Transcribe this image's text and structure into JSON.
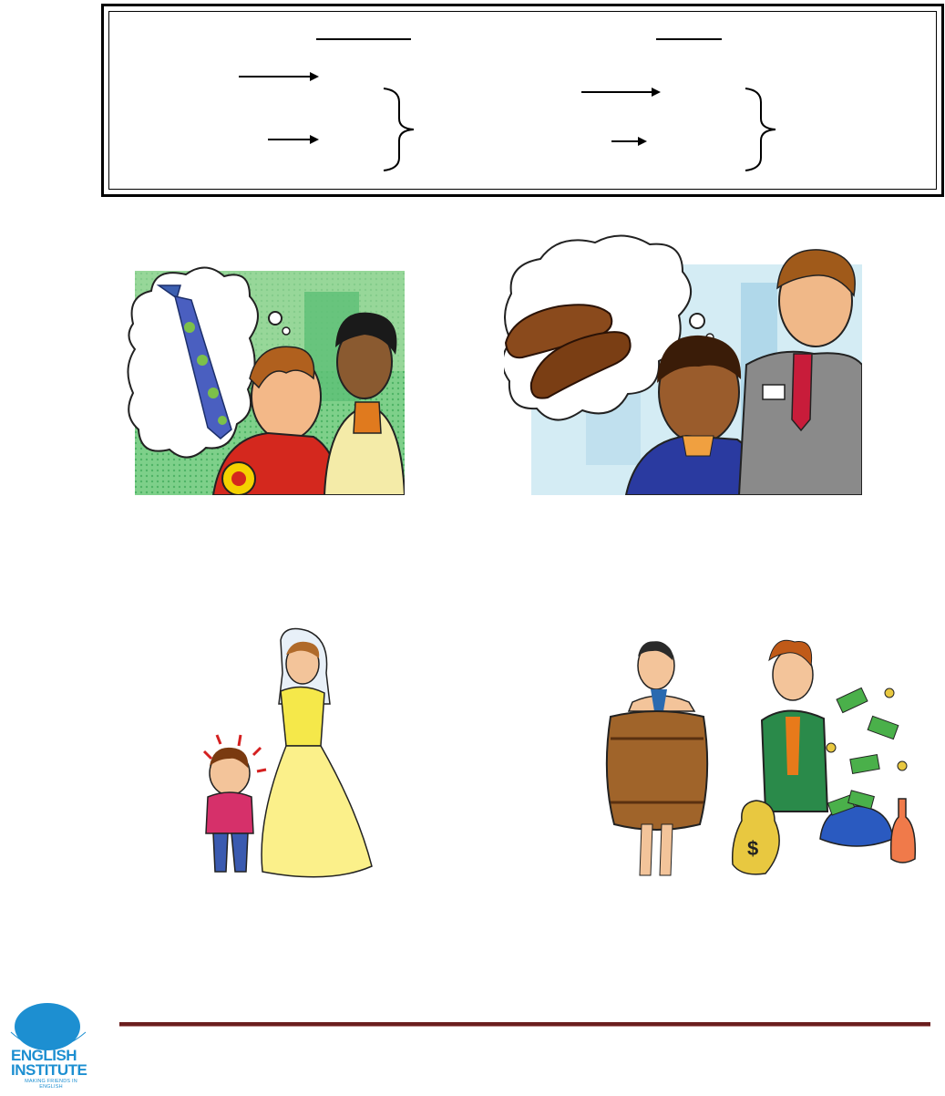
{
  "footer": {
    "logo_line1": "ENGLISH",
    "logo_line2": "INSTITUTE",
    "logo_tagline": "MAKING FRIENDS IN ENGLISH"
  },
  "colors": {
    "footer_rule": "#6b1e1e",
    "logo_blue": "#1d8fd1"
  },
  "illustrations": [
    {
      "name": "tie-thought-bubble-scene",
      "depicts": "boy thinking of a tie, saleswoman pointing"
    },
    {
      "name": "shoes-thought-bubble-scene",
      "depicts": "boy thinking of shoes, salesman pointing"
    },
    {
      "name": "short-man-and-bride",
      "depicts": "short man beside tall bride in yellow dress"
    },
    {
      "name": "poor-man-and-rich-man",
      "depicts": "man in barrel beside man with money"
    }
  ]
}
